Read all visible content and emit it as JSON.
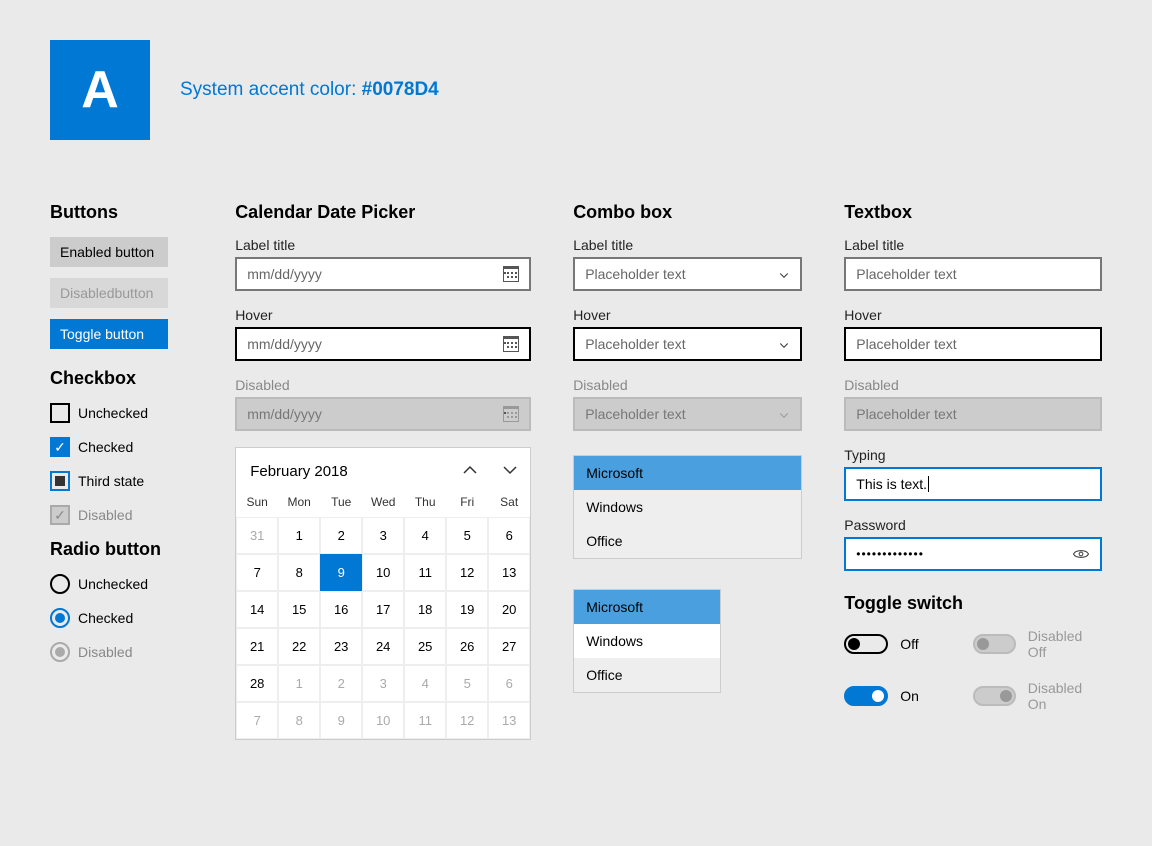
{
  "accent": {
    "swatch_letter": "A",
    "label_prefix": "System accent color: ",
    "hex": "#0078D4"
  },
  "buttons": {
    "title": "Buttons",
    "enabled": "Enabled button",
    "disabled": "Disabledbutton",
    "toggle": "Toggle button"
  },
  "checkbox": {
    "title": "Checkbox",
    "unchecked": "Unchecked",
    "checked": "Checked",
    "third": "Third state",
    "disabled": "Disabled"
  },
  "radio": {
    "title": "Radio button",
    "unchecked": "Unchecked",
    "checked": "Checked",
    "disabled": "Disabled"
  },
  "calendar": {
    "title": "Calendar Date Picker",
    "label": "Label title",
    "hover": "Hover",
    "disabled": "Disabled",
    "placeholder": "mm/dd/yyyy",
    "month": "February 2018",
    "dow": [
      "Sun",
      "Mon",
      "Tue",
      "Wed",
      "Thu",
      "Fri",
      "Sat"
    ],
    "rows": [
      [
        "31",
        "1",
        "2",
        "3",
        "4",
        "5",
        "6"
      ],
      [
        "7",
        "8",
        "9",
        "10",
        "11",
        "12",
        "13"
      ],
      [
        "14",
        "15",
        "16",
        "17",
        "18",
        "19",
        "20"
      ],
      [
        "21",
        "22",
        "23",
        "24",
        "25",
        "26",
        "27"
      ],
      [
        "28",
        "1",
        "2",
        "3",
        "4",
        "5",
        "6"
      ],
      [
        "7",
        "8",
        "9",
        "10",
        "11",
        "12",
        "13"
      ]
    ],
    "selected": "9"
  },
  "combo": {
    "title": "Combo box",
    "label": "Label title",
    "hover": "Hover",
    "disabled": "Disabled",
    "placeholder": "Placeholder text",
    "items": [
      "Microsoft",
      "Windows",
      "Office"
    ]
  },
  "textbox": {
    "title": "Textbox",
    "label": "Label title",
    "hover": "Hover",
    "disabled": "Disabled",
    "placeholder": "Placeholder text",
    "typing_label": "Typing",
    "typing_value": "This is text.",
    "password_label": "Password",
    "password_mask": "•••••••••••••"
  },
  "toggle": {
    "title": "Toggle switch",
    "off": "Off",
    "on": "On",
    "dis_off": "Disabled Off",
    "dis_on": "Disabled On"
  }
}
